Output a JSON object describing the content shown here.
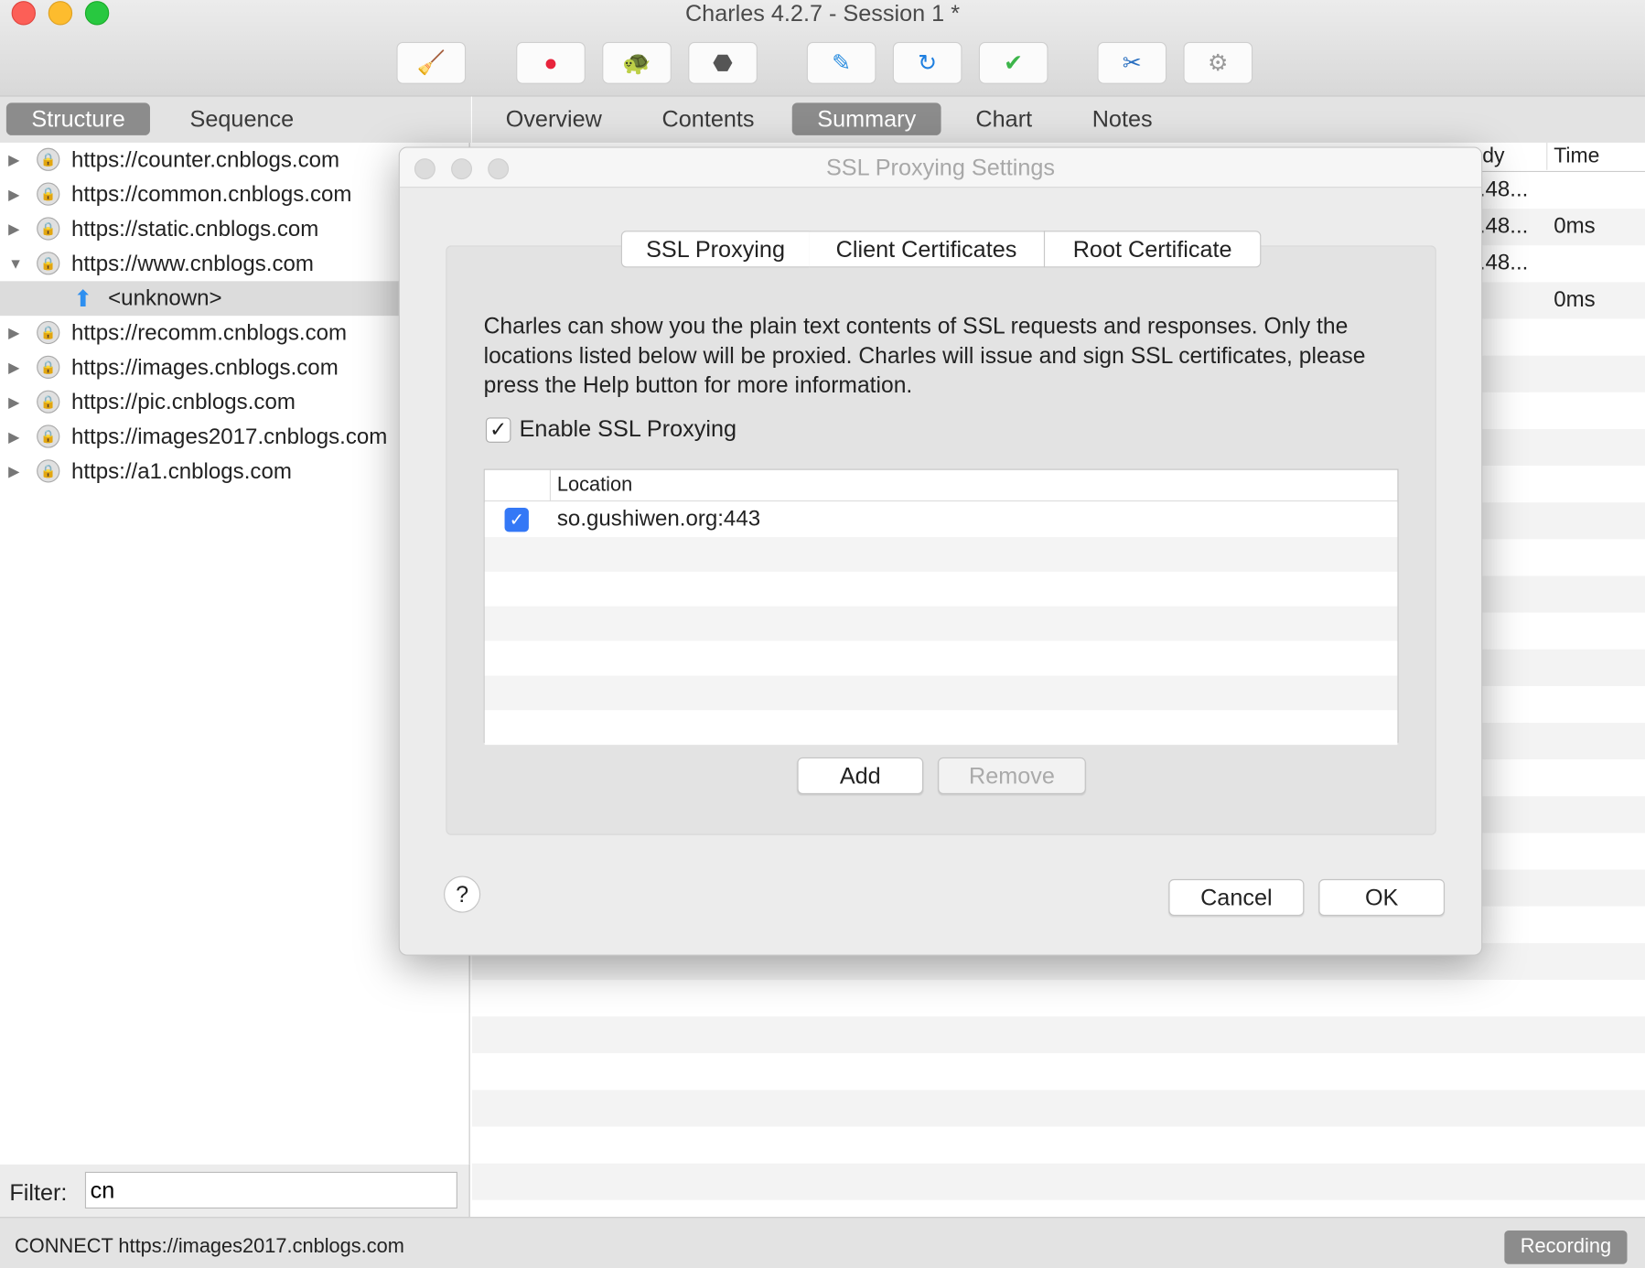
{
  "window": {
    "title": "Charles 4.2.7 - Session 1 *"
  },
  "toolbar": {
    "buttons": [
      {
        "name": "broom-icon",
        "glyph": "🧹"
      },
      {
        "name": "record-icon",
        "glyph": "●"
      },
      {
        "name": "turtle-icon",
        "glyph": "🐢"
      },
      {
        "name": "stop-hexagon-icon",
        "glyph": "⬣"
      },
      {
        "name": "pen-icon",
        "glyph": "✎"
      },
      {
        "name": "refresh-icon",
        "glyph": "↻"
      },
      {
        "name": "checkmark-icon",
        "glyph": "✔"
      },
      {
        "name": "tools-icon",
        "glyph": "✂"
      },
      {
        "name": "gear-icon",
        "glyph": "⚙"
      }
    ]
  },
  "left_tabs": [
    "Structure",
    "Sequence"
  ],
  "right_tabs": [
    "Overview",
    "Contents",
    "Summary",
    "Chart",
    "Notes"
  ],
  "tree": [
    {
      "label": "https://counter.cnblogs.com",
      "expanded": false
    },
    {
      "label": "https://common.cnblogs.com",
      "expanded": false
    },
    {
      "label": "https://static.cnblogs.com",
      "expanded": false
    },
    {
      "label": "https://www.cnblogs.com",
      "expanded": true
    },
    {
      "label": "<unknown>",
      "child": true,
      "selected": true
    },
    {
      "label": "https://recomm.cnblogs.com",
      "expanded": false
    },
    {
      "label": "https://images.cnblogs.com",
      "expanded": false
    },
    {
      "label": "https://pic.cnblogs.com",
      "expanded": false
    },
    {
      "label": "https://images2017.cnblogs.com",
      "expanded": false
    },
    {
      "label": "https://a1.cnblogs.com",
      "expanded": false
    }
  ],
  "summary_table": {
    "headers": [
      "dy",
      "Time"
    ],
    "rows": [
      [
        ".48...",
        ""
      ],
      [
        ".48...",
        "0ms"
      ],
      [
        ".48...",
        ""
      ],
      [
        "",
        "0ms"
      ]
    ]
  },
  "filter": {
    "label": "Filter:",
    "value": "cn"
  },
  "status": {
    "text": "CONNECT https://images2017.cnblogs.com",
    "recording": "Recording"
  },
  "dialog": {
    "title": "SSL Proxying Settings",
    "tabs": [
      "SSL Proxying",
      "Client Certificates",
      "Root Certificate"
    ],
    "description": "Charles can show you the plain text contents of SSL requests and responses. Only the locations listed below will be proxied. Charles will issue and sign SSL certificates, please press the Help button for more information.",
    "enable_label": "Enable SSL Proxying",
    "enable_checked": true,
    "table_header": "Location",
    "locations": [
      {
        "location": "so.gushiwen.org:443",
        "enabled": true
      }
    ],
    "add": "Add",
    "remove": "Remove",
    "help": "?",
    "cancel": "Cancel",
    "ok": "OK"
  },
  "colors": {
    "accent": "#3478f6",
    "selected_tab": "#8c8c8c"
  }
}
